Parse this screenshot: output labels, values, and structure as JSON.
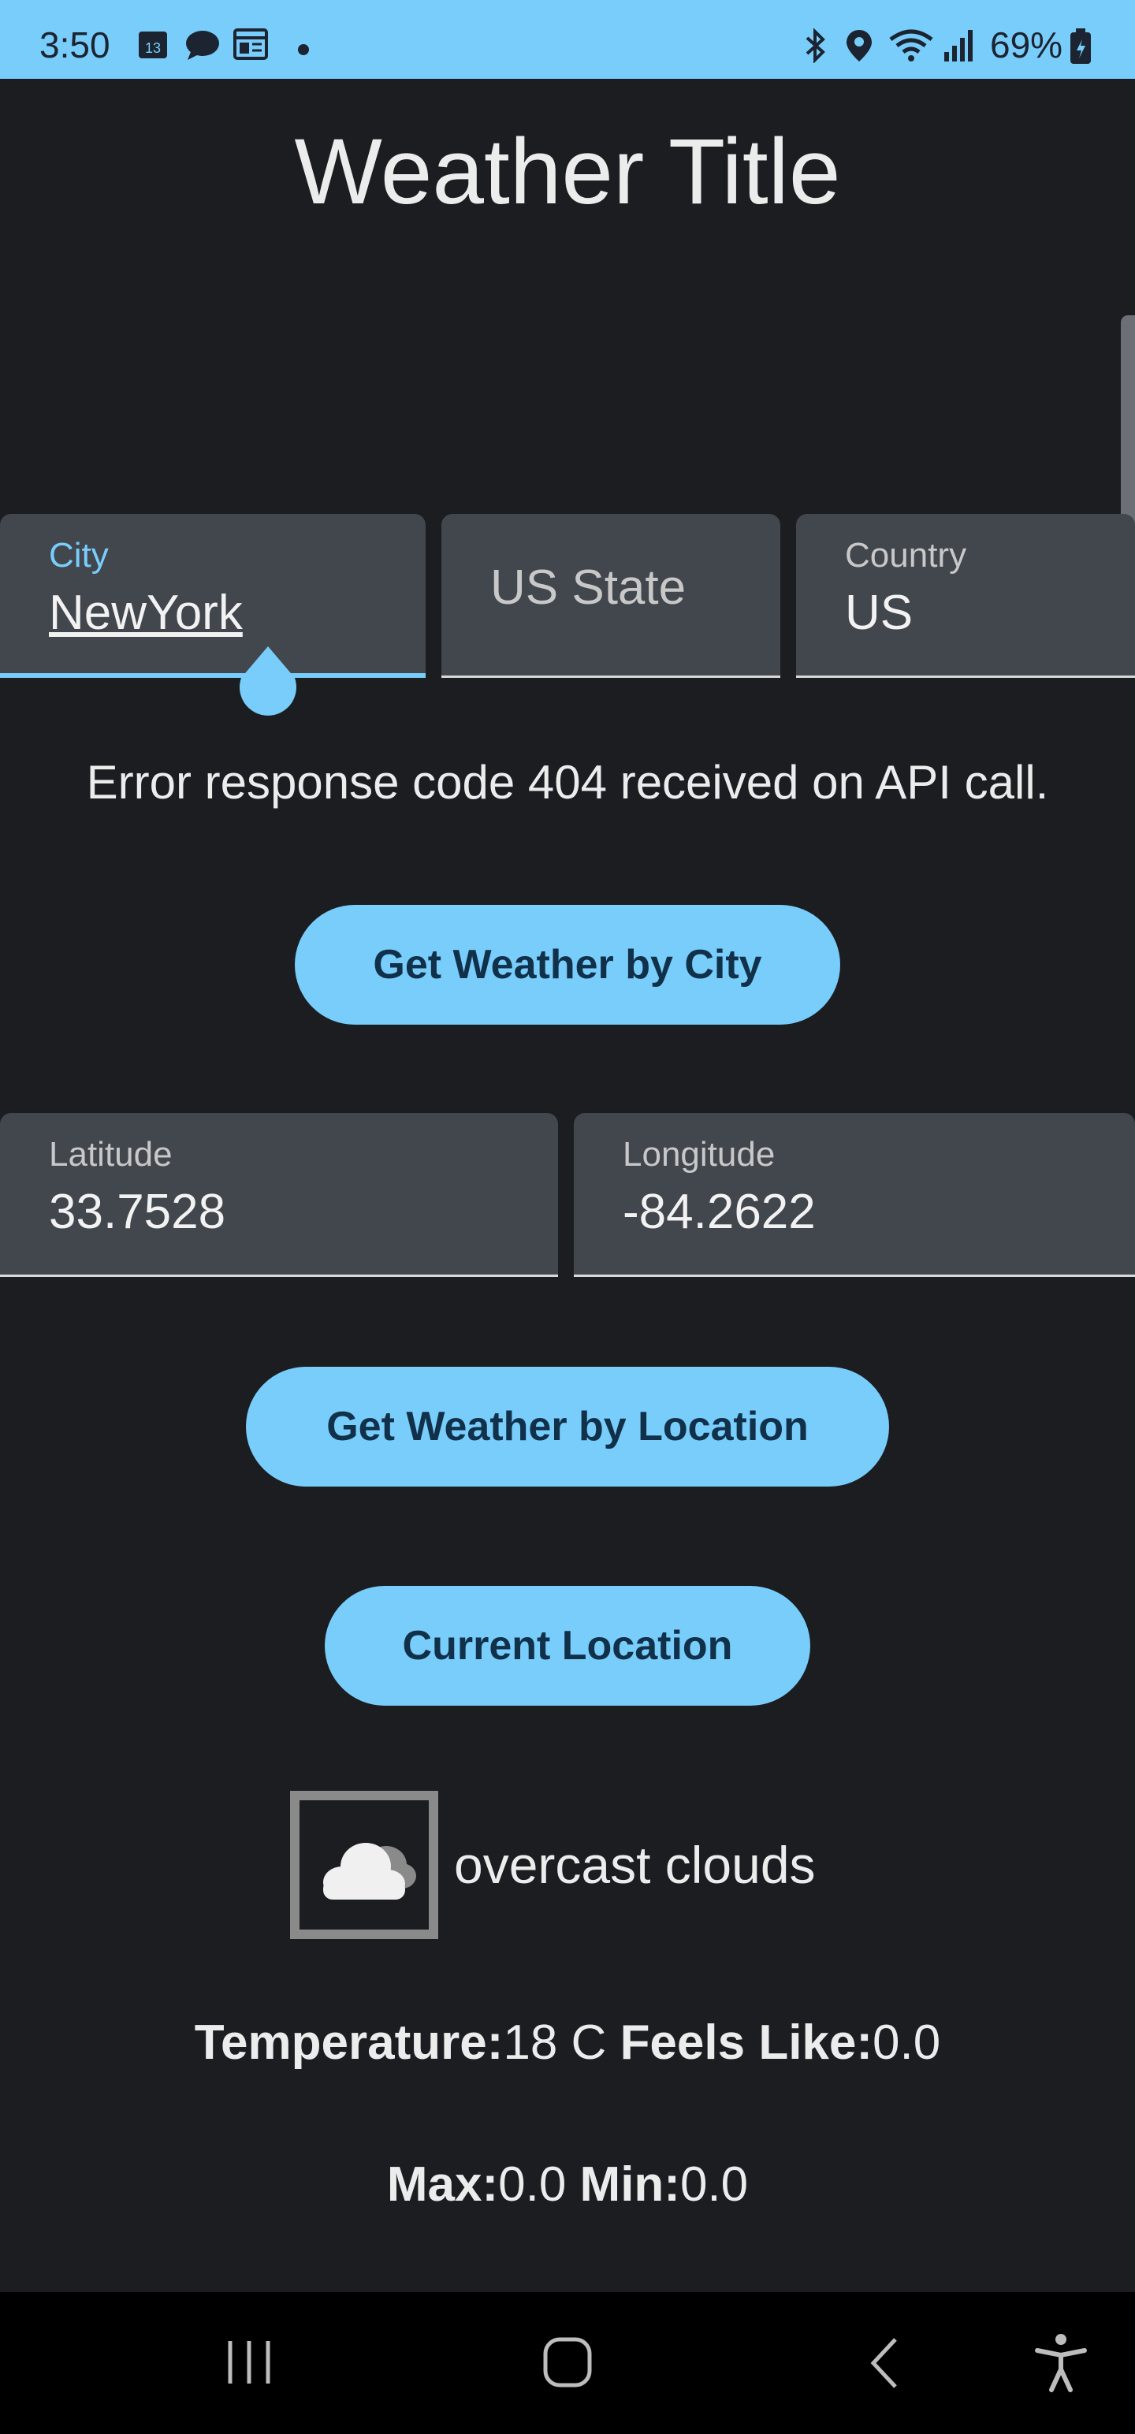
{
  "status_bar": {
    "time": "3:50",
    "calendar_day": "13",
    "battery": "69%",
    "icons": [
      "calendar-icon",
      "chat-icon",
      "news-icon",
      "dot-icon",
      "bluetooth-icon",
      "location-icon",
      "wifi-icon",
      "signal-icon",
      "battery-icon"
    ]
  },
  "title": "Weather Title",
  "city_field": {
    "label": "City",
    "value": "NewYork"
  },
  "state_field": {
    "placeholder": "US State"
  },
  "country_field": {
    "label": "Country",
    "value": "US"
  },
  "error_message": "Error response code 404 received on API call.",
  "buttons": {
    "by_city": "Get Weather by City",
    "by_location": "Get Weather by Location",
    "current_location": "Current Location"
  },
  "latitude_field": {
    "label": "Latitude",
    "value": "33.7528"
  },
  "longitude_field": {
    "label": "Longitude",
    "value": "-84.2622"
  },
  "weather": {
    "icon": "cloud-icon",
    "description": "overcast clouds",
    "temperature_label": "Temperature:",
    "temperature_value": "18 C",
    "feels_like_label": "Feels Like:",
    "feels_like_value": "0.0",
    "max_label": "Max:",
    "max_value": "0.0",
    "min_label": "Min:",
    "min_value": "0.0"
  },
  "nav_bar": {
    "icons": [
      "recent-apps-icon",
      "home-icon",
      "back-icon",
      "accessibility-icon"
    ]
  },
  "colors": {
    "accent": "#78cdfb",
    "background": "#1b1d21",
    "field": "#42464d"
  }
}
